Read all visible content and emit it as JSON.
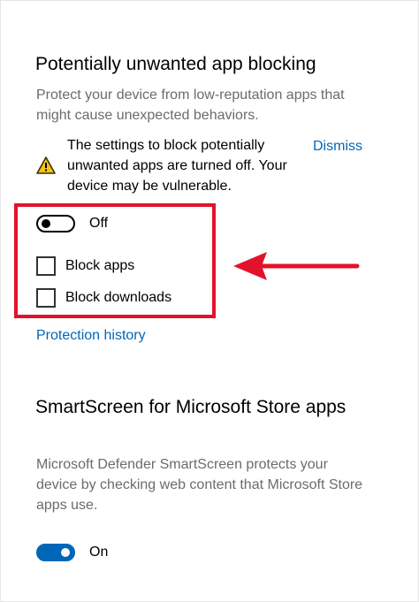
{
  "pua": {
    "title": "Potentially unwanted app blocking",
    "description": "Protect your device from low-reputation apps that might cause unexpected behaviors.",
    "warning": {
      "icon": "warning-icon",
      "text": "The settings to block potentially unwanted apps are turned off. Your device may be vulnerable.",
      "dismiss_label": "Dismiss"
    },
    "toggle": {
      "state": "off",
      "label": "Off"
    },
    "checkboxes": [
      {
        "label": "Block apps",
        "checked": false
      },
      {
        "label": "Block downloads",
        "checked": false
      }
    ],
    "history_link": "Protection history"
  },
  "smartscreen": {
    "title": "SmartScreen for Microsoft Store apps",
    "description": "Microsoft Defender SmartScreen protects your device by checking web content that Microsoft Store apps use.",
    "toggle": {
      "state": "on",
      "label": "On"
    }
  },
  "colors": {
    "accent": "#0067b8",
    "highlight": "#e3122c",
    "warning_icon": "#f0c419",
    "secondary_text": "#6b6b6b"
  }
}
